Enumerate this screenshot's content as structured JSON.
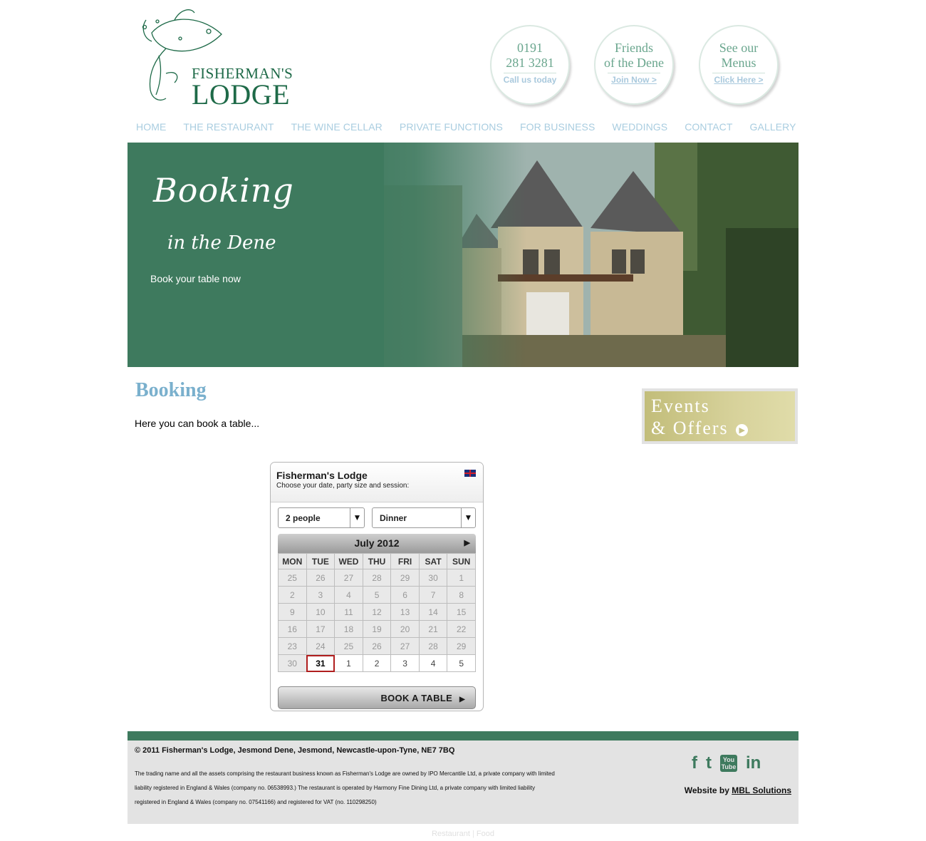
{
  "logo": {
    "line1": "FISHERMAN'S",
    "line2": "LODGE"
  },
  "circles": [
    {
      "main_top": "0191",
      "main_bottom": "281 3281",
      "sub": "Call us today"
    },
    {
      "main_top": "Friends",
      "main_bottom": "of the Dene",
      "sub": "Join Now >"
    },
    {
      "main_top": "See our",
      "main_bottom": "Menus",
      "sub": "Click Here >"
    }
  ],
  "nav": [
    "HOME",
    "THE RESTAURANT",
    "THE WINE CELLAR",
    "PRIVATE FUNCTIONS",
    "FOR BUSINESS",
    "WEDDINGS",
    "CONTACT",
    "GALLERY"
  ],
  "banner": {
    "script_line1": "Booking",
    "script_line2": "in the Dene",
    "tagline": "Book your table now"
  },
  "main": {
    "heading": "Booking",
    "intro": "Here you can book a table..."
  },
  "events": {
    "line1": "Events",
    "line2": "& Offers"
  },
  "widget": {
    "title": "Fisherman's Lodge",
    "subtitle": "Choose your date, party size and session:",
    "party_size": "2 people",
    "session": "Dinner",
    "calendar": {
      "month": "July 2012",
      "days": [
        "MON",
        "TUE",
        "WED",
        "THU",
        "FRI",
        "SAT",
        "SUN"
      ],
      "weeks": [
        [
          "25",
          "26",
          "27",
          "28",
          "29",
          "30",
          "1"
        ],
        [
          "2",
          "3",
          "4",
          "5",
          "6",
          "7",
          "8"
        ],
        [
          "9",
          "10",
          "11",
          "12",
          "13",
          "14",
          "15"
        ],
        [
          "16",
          "17",
          "18",
          "19",
          "20",
          "21",
          "22"
        ],
        [
          "23",
          "24",
          "25",
          "26",
          "27",
          "28",
          "29"
        ],
        [
          "30",
          "31",
          "1",
          "2",
          "3",
          "4",
          "5"
        ]
      ],
      "selected": "31"
    },
    "book_button": "BOOK A TABLE"
  },
  "footer": {
    "copyright": "© 2011 Fisherman's Lodge, Jesmond Dene, Jesmond, Newcastle-upon-Tyne, NE7 7BQ",
    "legal": "The trading name and all the assets comprising the restaurant business known as Fisherman's Lodge are owned by IPO Mercantile Ltd, a private company with limited liability registered in England & Wales (company no. 06538993.) The restaurant is operated by Harmony Fine Dining Ltd, a private company with limited liability registered in England & Wales (company no. 07541166) and registered for VAT (no. 110298250)",
    "credit_prefix": "Website by",
    "credit_link": "MBL Solutions",
    "social": [
      "facebook-icon",
      "twitter-icon",
      "youtube-icon",
      "linkedin-icon"
    ],
    "youtube_text": "You Tube"
  },
  "bottom_links": [
    "Restaurant",
    "Food"
  ],
  "colors": {
    "brand_green": "#3e7a5e",
    "nav_blue": "#a9cde0",
    "heading_blue": "#7ab0cd"
  }
}
